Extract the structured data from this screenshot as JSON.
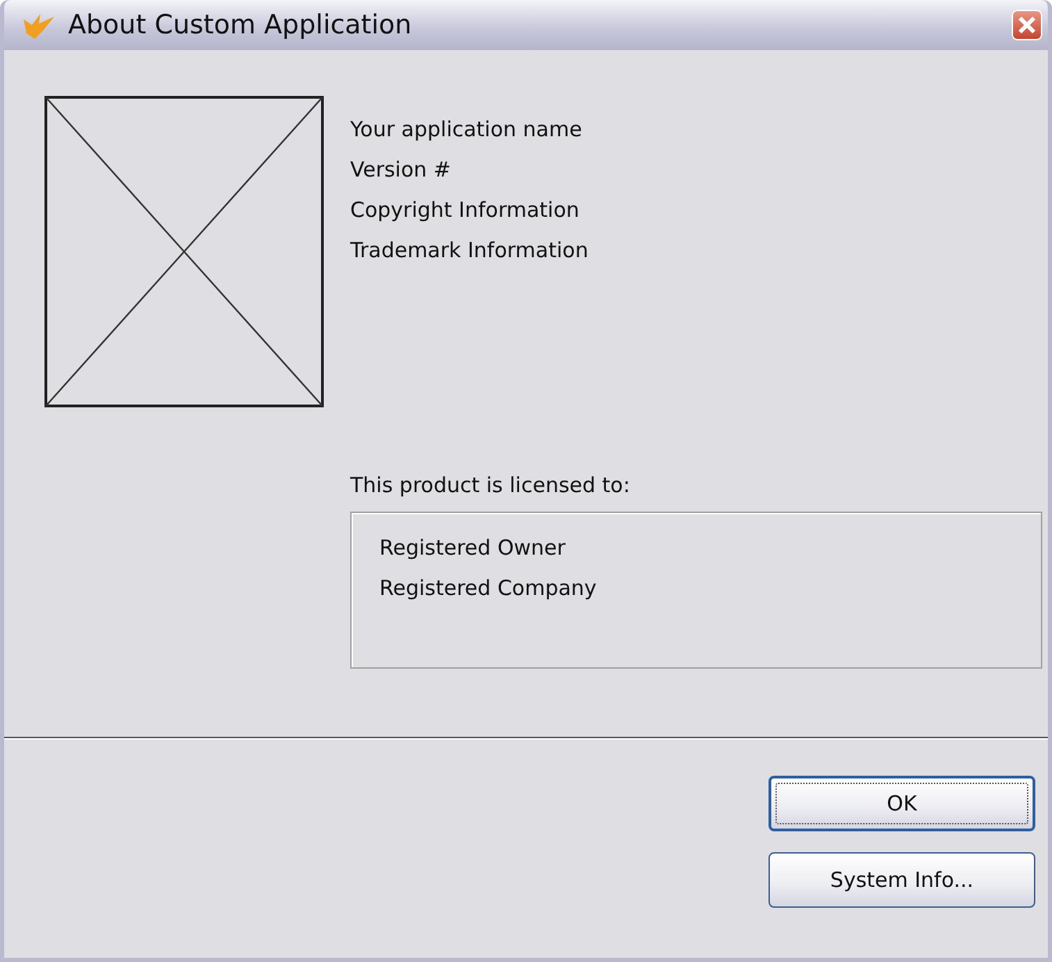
{
  "window": {
    "title": "About Custom Application"
  },
  "info_lines": [
    "Your application name",
    "Version #",
    "Copyright Information",
    "Trademark Information"
  ],
  "license": {
    "caption": "This product is licensed to:",
    "lines": [
      "Registered Owner",
      "Registered Company"
    ]
  },
  "buttons": [
    {
      "label": "OK",
      "default": true
    },
    {
      "label": "System Info...",
      "default": false
    }
  ]
}
